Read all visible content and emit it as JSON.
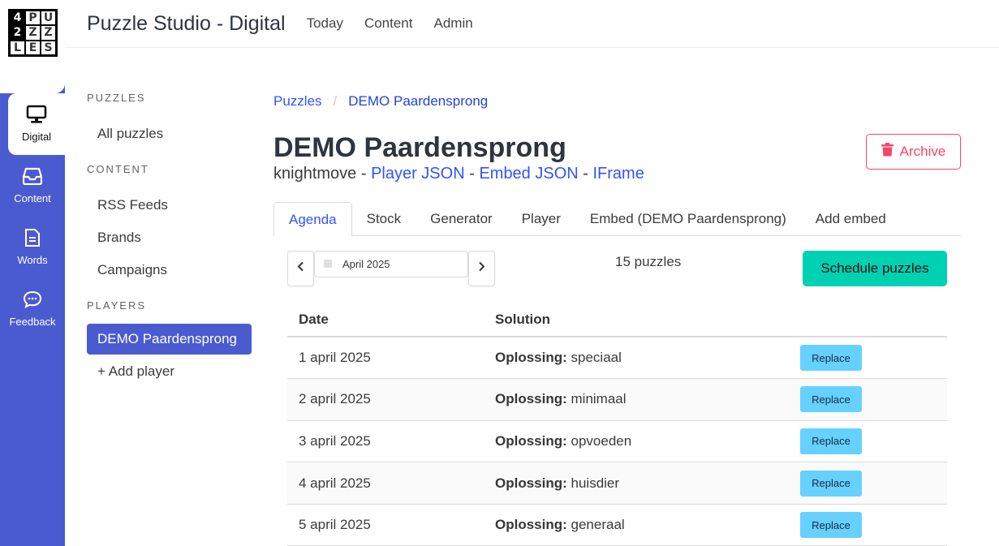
{
  "logo": {
    "cells": [
      "4",
      "P",
      "U",
      "2",
      "Z",
      "Z",
      "L",
      "E",
      "S"
    ]
  },
  "rail": [
    {
      "label": "Digital",
      "icon": "monitor-icon"
    },
    {
      "label": "Content",
      "icon": "inbox-icon"
    },
    {
      "label": "Words",
      "icon": "document-icon"
    },
    {
      "label": "Feedback",
      "icon": "chat-bubble-icon"
    }
  ],
  "topbar": {
    "brand": "Puzzle Studio - Digital",
    "nav": [
      "Today",
      "Content",
      "Admin"
    ]
  },
  "sidenav": {
    "puzzles_label": "PUZZLES",
    "puzzles": [
      "All puzzles"
    ],
    "content_label": "CONTENT",
    "content": [
      "RSS Feeds",
      "Brands",
      "Campaigns"
    ],
    "players_label": "PLAYERS",
    "players": [
      "DEMO Paardensprong",
      "+ Add player"
    ]
  },
  "breadcrumb": {
    "root": "Puzzles",
    "sep": "/",
    "current": "DEMO Paardensprong"
  },
  "header": {
    "title": "DEMO Paardensprong",
    "type": "knightmove",
    "dash": " - ",
    "links": [
      "Player JSON",
      "Embed JSON",
      "IFrame"
    ],
    "archive_label": "Archive"
  },
  "tabs": [
    "Agenda",
    "Stock",
    "Generator",
    "Player",
    "Embed (DEMO Paardensprong)",
    "Add embed"
  ],
  "controls": {
    "month": "April 2025",
    "count": "15 puzzles",
    "schedule_label": "Schedule puzzles"
  },
  "table": {
    "columns": [
      "Date",
      "Solution"
    ],
    "solution_key": "Oplossing:",
    "replace_label": "Replace",
    "rows": [
      {
        "date": "1 april 2025",
        "solution": "speciaal"
      },
      {
        "date": "2 april 2025",
        "solution": "minimaal"
      },
      {
        "date": "3 april 2025",
        "solution": "opvoeden"
      },
      {
        "date": "4 april 2025",
        "solution": "huisdier"
      },
      {
        "date": "5 april 2025",
        "solution": "generaal"
      }
    ]
  },
  "colors": {
    "rail": "#4a5bd0",
    "link": "#3352ff",
    "primary": "#00d1b2",
    "danger": "#f14668",
    "info": "#66d1ff"
  }
}
